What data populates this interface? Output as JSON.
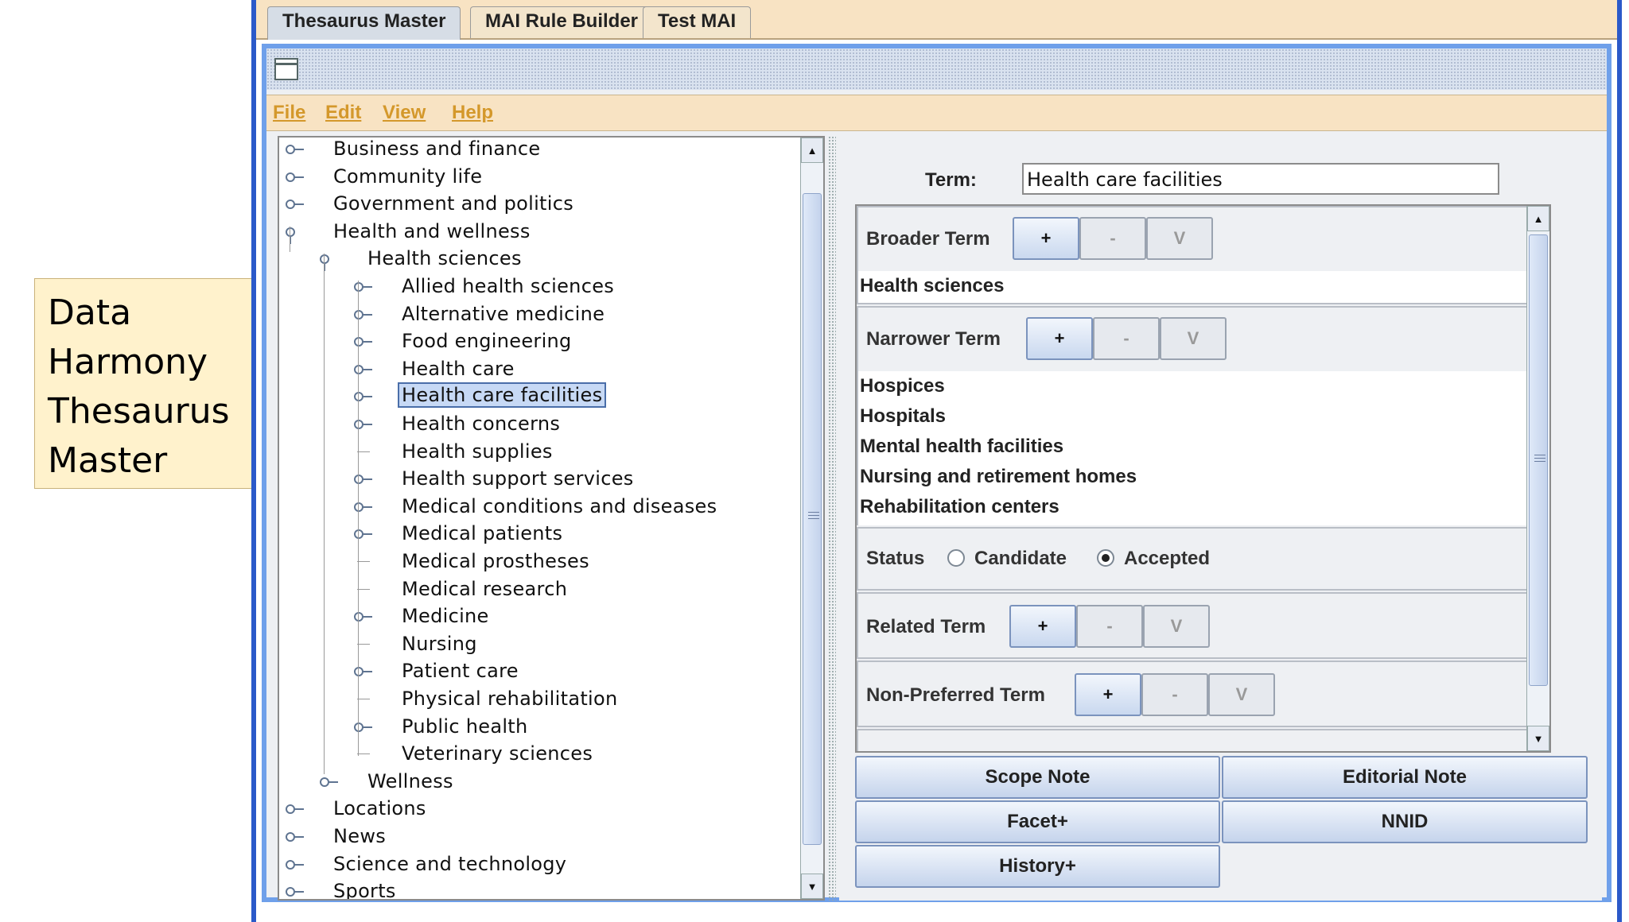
{
  "caption": [
    "Data",
    "Harmony",
    "Thesaurus",
    "Master"
  ],
  "tabs": [
    {
      "label": "Thesaurus Master",
      "active": true
    },
    {
      "label": "MAI Rule Builder",
      "active": false
    },
    {
      "label": "Test MAI",
      "active": false
    }
  ],
  "menu": [
    "File",
    "Edit",
    "View",
    "Help"
  ],
  "tree": [
    {
      "label": "Business and finance",
      "level": 0,
      "icon": "node-collapsed"
    },
    {
      "label": "Community life",
      "level": 0,
      "icon": "node-collapsed"
    },
    {
      "label": "Government and politics",
      "level": 0,
      "icon": "node-collapsed"
    },
    {
      "label": "Health and wellness",
      "level": 0,
      "icon": "node-expanded"
    },
    {
      "label": "Health sciences",
      "level": 1,
      "icon": "node-expanded"
    },
    {
      "label": "Allied health sciences",
      "level": 2,
      "icon": "node-collapsed"
    },
    {
      "label": "Alternative medicine",
      "level": 2,
      "icon": "node-collapsed"
    },
    {
      "label": "Food engineering",
      "level": 2,
      "icon": "node-collapsed"
    },
    {
      "label": "Health care",
      "level": 2,
      "icon": "node-collapsed"
    },
    {
      "label": "Health care facilities",
      "level": 2,
      "icon": "node-collapsed",
      "selected": true
    },
    {
      "label": "Health concerns",
      "level": 2,
      "icon": "node-collapsed"
    },
    {
      "label": "Health supplies",
      "level": 2,
      "icon": "leaf"
    },
    {
      "label": "Health support services",
      "level": 2,
      "icon": "node-collapsed"
    },
    {
      "label": "Medical conditions and diseases",
      "level": 2,
      "icon": "node-collapsed"
    },
    {
      "label": "Medical patients",
      "level": 2,
      "icon": "node-collapsed"
    },
    {
      "label": "Medical prostheses",
      "level": 2,
      "icon": "leaf"
    },
    {
      "label": "Medical research",
      "level": 2,
      "icon": "leaf"
    },
    {
      "label": "Medicine",
      "level": 2,
      "icon": "node-collapsed"
    },
    {
      "label": "Nursing",
      "level": 2,
      "icon": "leaf"
    },
    {
      "label": "Patient care",
      "level": 2,
      "icon": "node-collapsed"
    },
    {
      "label": "Physical rehabilitation",
      "level": 2,
      "icon": "leaf"
    },
    {
      "label": "Public health",
      "level": 2,
      "icon": "node-collapsed"
    },
    {
      "label": "Veterinary sciences",
      "level": 2,
      "icon": "leaf"
    },
    {
      "label": "Wellness",
      "level": 1,
      "icon": "node-collapsed"
    },
    {
      "label": "Locations",
      "level": 0,
      "icon": "node-collapsed"
    },
    {
      "label": "News",
      "level": 0,
      "icon": "node-collapsed"
    },
    {
      "label": "Science and technology",
      "level": 0,
      "icon": "node-collapsed"
    },
    {
      "label": "Sports",
      "level": 0,
      "icon": "node-collapsed"
    }
  ],
  "term": {
    "label": "Term:",
    "value": "Health care facilities"
  },
  "sections": {
    "broader": {
      "title": "Broader Term",
      "items": [
        "Health sciences"
      ]
    },
    "narrower": {
      "title": "Narrower Term",
      "items": [
        "Hospices",
        "Hospitals",
        "Mental health facilities",
        "Nursing and retirement homes",
        "Rehabilitation centers"
      ]
    },
    "status": {
      "title": "Status",
      "options": [
        "Candidate",
        "Accepted"
      ],
      "selected": "Accepted"
    },
    "related": {
      "title": "Related Term"
    },
    "nonpreferred": {
      "title": "Non-Preferred Term"
    }
  },
  "mini_buttons": {
    "add": "+",
    "remove": "-",
    "view": "V"
  },
  "actions": {
    "scope_note": "Scope Note",
    "editorial_note": "Editorial Note",
    "facet": "Facet+",
    "nnid": "NNID",
    "history": "History+"
  }
}
